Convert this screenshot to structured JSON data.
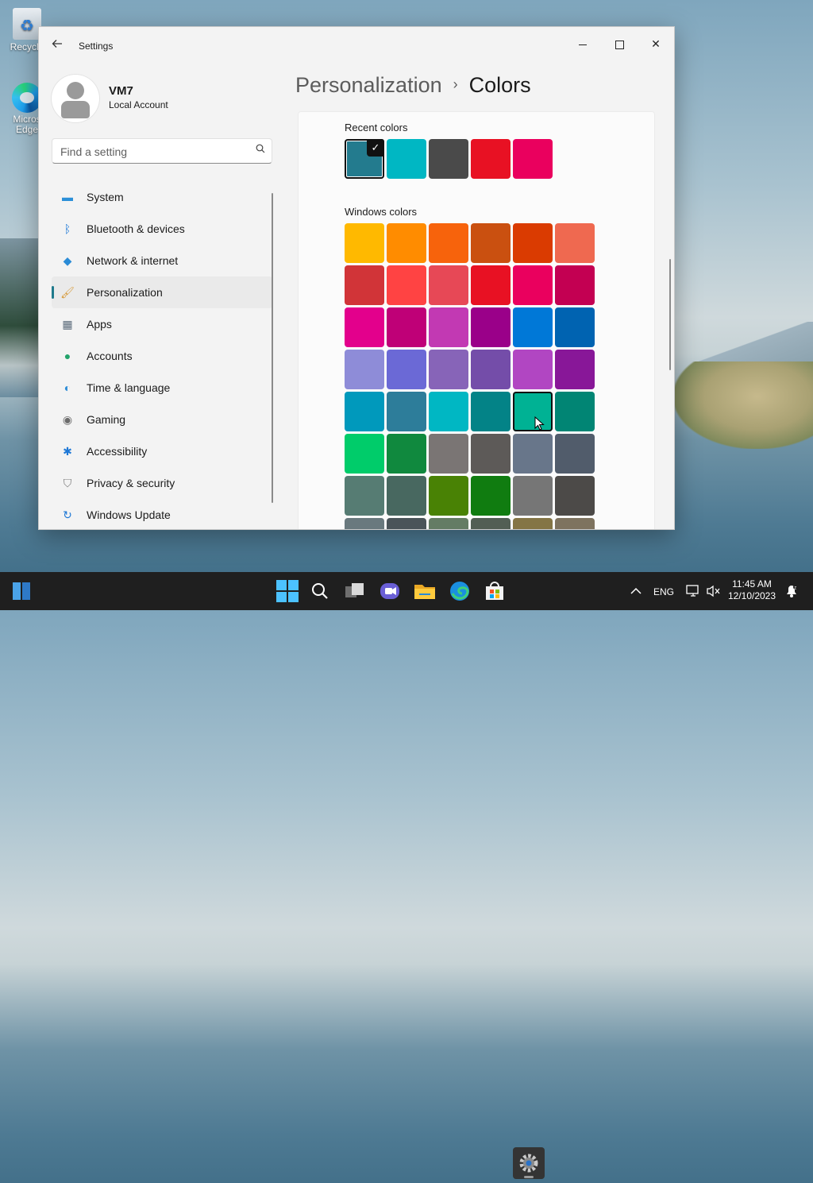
{
  "desktop": {
    "icons": [
      {
        "label": "Recycle"
      },
      {
        "label": "Micros Edge"
      }
    ]
  },
  "window": {
    "title": "Settings",
    "controls": {
      "minimize": "minimize",
      "maximize": "maximize",
      "close": "✕"
    }
  },
  "profile": {
    "name": "VM7",
    "account_type": "Local Account"
  },
  "search": {
    "placeholder": "Find a setting"
  },
  "nav": {
    "items": [
      {
        "label": "System",
        "icon": "monitor-icon",
        "color": "#2b8fd8"
      },
      {
        "label": "Bluetooth & devices",
        "icon": "bluetooth-icon",
        "color": "#1e78d6"
      },
      {
        "label": "Network & internet",
        "icon": "wifi-icon",
        "color": "#2a8bd6"
      },
      {
        "label": "Personalization",
        "icon": "brush-icon",
        "color": "#d79a3a",
        "active": true
      },
      {
        "label": "Apps",
        "icon": "apps-icon",
        "color": "#5a6a7a"
      },
      {
        "label": "Accounts",
        "icon": "person-icon",
        "color": "#23a36b"
      },
      {
        "label": "Time & language",
        "icon": "globe-clock-icon",
        "color": "#2a8bd6"
      },
      {
        "label": "Gaming",
        "icon": "gamepad-icon",
        "color": "#6b6b6b"
      },
      {
        "label": "Accessibility",
        "icon": "accessibility-icon",
        "color": "#1e78d6"
      },
      {
        "label": "Privacy & security",
        "icon": "shield-icon",
        "color": "#7a7a7a"
      },
      {
        "label": "Windows Update",
        "icon": "update-icon",
        "color": "#1e78d6"
      }
    ]
  },
  "breadcrumb": {
    "parent": "Personalization",
    "separator": "›",
    "current": "Colors"
  },
  "colors": {
    "recent_label": "Recent colors",
    "recent": [
      "#237b8e",
      "#00b7c3",
      "#4a4a4a",
      "#e81123",
      "#ea005e"
    ],
    "recent_selected_index": 0,
    "windows_label": "Windows colors",
    "hover_index": 28,
    "windows": [
      "#ffb900",
      "#ff8c00",
      "#f7630c",
      "#ca5010",
      "#da3b01",
      "#ef6950",
      "#d13438",
      "#ff4343",
      "#e74856",
      "#e81123",
      "#ea005e",
      "#c30052",
      "#e3008c",
      "#bf0077",
      "#c239b3",
      "#9a0089",
      "#0078d7",
      "#0063b1",
      "#8e8cd8",
      "#6b69d6",
      "#8764b8",
      "#744da9",
      "#b146c2",
      "#881798",
      "#0099bc",
      "#2d7d9a",
      "#00b7c3",
      "#038387",
      "#00b294",
      "#018574",
      "#00cc6a",
      "#10893e",
      "#7a7574",
      "#5d5a58",
      "#68768a",
      "#515c6b",
      "#567c73",
      "#486860",
      "#498205",
      "#107c10",
      "#767676",
      "#4c4a48",
      "#69797e",
      "#4a5459",
      "#647c64",
      "#525e54",
      "#847545",
      "#7e735f"
    ]
  },
  "taskbar": {
    "apps": [
      "start-icon",
      "search-icon",
      "task-view-icon",
      "teams-chat-icon",
      "file-explorer-icon",
      "edge-icon",
      "store-icon",
      "settings-icon"
    ],
    "tray": {
      "language": "ENG",
      "time": "11:45 AM",
      "date": "12/10/2023"
    }
  }
}
